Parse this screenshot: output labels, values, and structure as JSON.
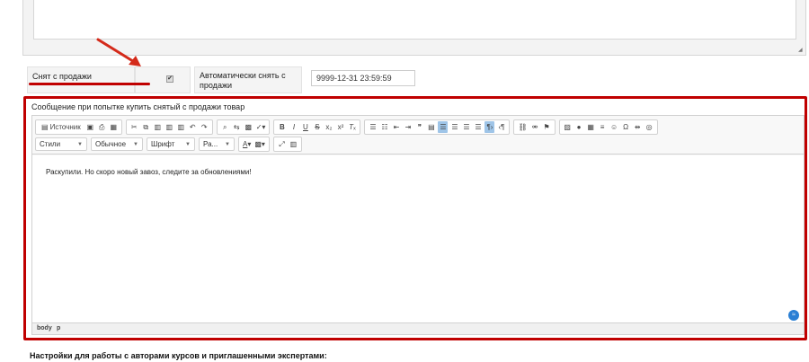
{
  "property": {
    "withdrawn_label": "Снят с продажи",
    "withdrawn_checked": true,
    "auto_withdraw_label_line1": "Автоматически снять с",
    "auto_withdraw_label_line2": "продажи",
    "auto_withdraw_value": "9999-12-31 23:59:59"
  },
  "editor": {
    "label": "Сообщение при попытке купить снятый с продажи товар",
    "source_button": "Источник",
    "combos": {
      "styles": "Стили",
      "format": "Обычное",
      "font": "Шрифт",
      "size": "Ра..."
    },
    "content_text": "Раскупили. Но скоро новый завоз, следите за обновлениями!",
    "path": [
      "body",
      "p"
    ]
  },
  "section": {
    "authors_title": "Настройки для работы с авторами курсов и приглашенными экспертами:"
  },
  "colors": {
    "highlight": "#c00000",
    "active_button": "#9fc5e8"
  }
}
